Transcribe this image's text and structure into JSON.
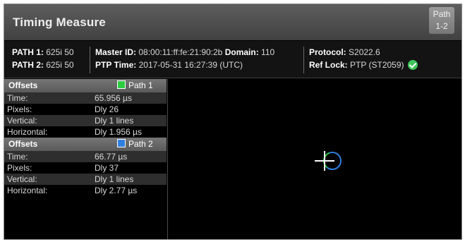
{
  "header": {
    "title": "Timing Measure",
    "path_button": {
      "line1": "Path",
      "line2": "1-2"
    }
  },
  "info": {
    "path1_label": "PATH 1:",
    "path1_value": "625i 50",
    "path2_label": "PATH 2:",
    "path2_value": "625i 50",
    "master_id_label": "Master ID:",
    "master_id_value": "08:00:11:ff:fe:21:90:2b",
    "domain_label": "Domain:",
    "domain_value": "110",
    "ptp_time_label": "PTP Time:",
    "ptp_time_value": "2017-05-31 16:27:39 (UTC)",
    "protocol_label": "Protocol:",
    "protocol_value": "S2022.6",
    "ref_lock_label": "Ref Lock:",
    "ref_lock_value": "PTP (ST2059)",
    "ref_lock_status_color": "#3fc45a"
  },
  "offsets": [
    {
      "header": "Offsets",
      "legend": "Path 1",
      "color": "#2ecc40",
      "rows": [
        {
          "label": "Time:",
          "value": "65.956 µs"
        },
        {
          "label": "Pixels:",
          "value": "Dly 26"
        },
        {
          "label": "Vertical:",
          "value": "Dly 1 lines"
        },
        {
          "label": "Horizontal:",
          "value": "Dly 1.956 µs"
        }
      ]
    },
    {
      "header": "Offsets",
      "legend": "Path 2",
      "color": "#2f7fe0",
      "rows": [
        {
          "label": "Time:",
          "value": "66.77 µs"
        },
        {
          "label": "Pixels:",
          "value": "Dly 37"
        },
        {
          "label": "Vertical:",
          "value": "Dly 1 lines"
        },
        {
          "label": "Horizontal:",
          "value": "Dly 2.77 µs"
        }
      ]
    }
  ],
  "plot": {
    "crosshair_color": "#ffffff",
    "ring_path1_color": "#2ecc40",
    "ring_path2_color": "#2f7fe0"
  }
}
